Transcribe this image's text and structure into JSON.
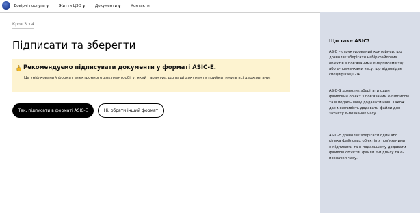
{
  "nav": {
    "items": [
      {
        "label": "Довірчі послуги",
        "has_dropdown": true
      },
      {
        "label": "Життя ЦЗО",
        "has_dropdown": true
      },
      {
        "label": "Документи",
        "has_dropdown": true
      },
      {
        "label": "Контакти",
        "has_dropdown": false
      }
    ],
    "dropdown_icon": "chevron-down-icon",
    "logo_icon": "emblem-logo"
  },
  "main": {
    "step": "Крок 3 з 4",
    "title": "Підписати та зберегти",
    "alert": {
      "icon": "pointing-hand-icon",
      "title": "Рекомендуємо підписувати документи у форматі ASIC-E.",
      "body": "Це уніфікований формат електронного документообігу, який гарантує, що ваші документи прийматимуть всі держоргани."
    },
    "buttons": {
      "primary": "Так, підписати в форматі ASIC-E",
      "secondary": "Ні, обрати інший формат"
    }
  },
  "aside": {
    "title": "Що таке ASIC?",
    "paragraphs": [
      "ASIC – структурований контейнер, що дозволяє зберігати набір файлових об'єктів з пов'язаними е-підписами та/або е-позначками часу, що відповідає специфікації ZIP.",
      "ASIC-S дозволяє зберігати один файловий об'єкт з пов'язаним е-підписом та в подальшому додавати нові. Також дає можливість додавати файли для захисту е-позначок часу.",
      "ASIC-E дозволяє зберігати один або кілька файлових об'єктів з пов'язаними е-підписами та в подальшому додавати файлові об'єкти, файли е-підпису та е-позначки часу."
    ]
  },
  "colors": {
    "alert_bg": "#fdf3d0",
    "sidebar_bg": "#d8dde8",
    "primary_button": "#000000"
  }
}
